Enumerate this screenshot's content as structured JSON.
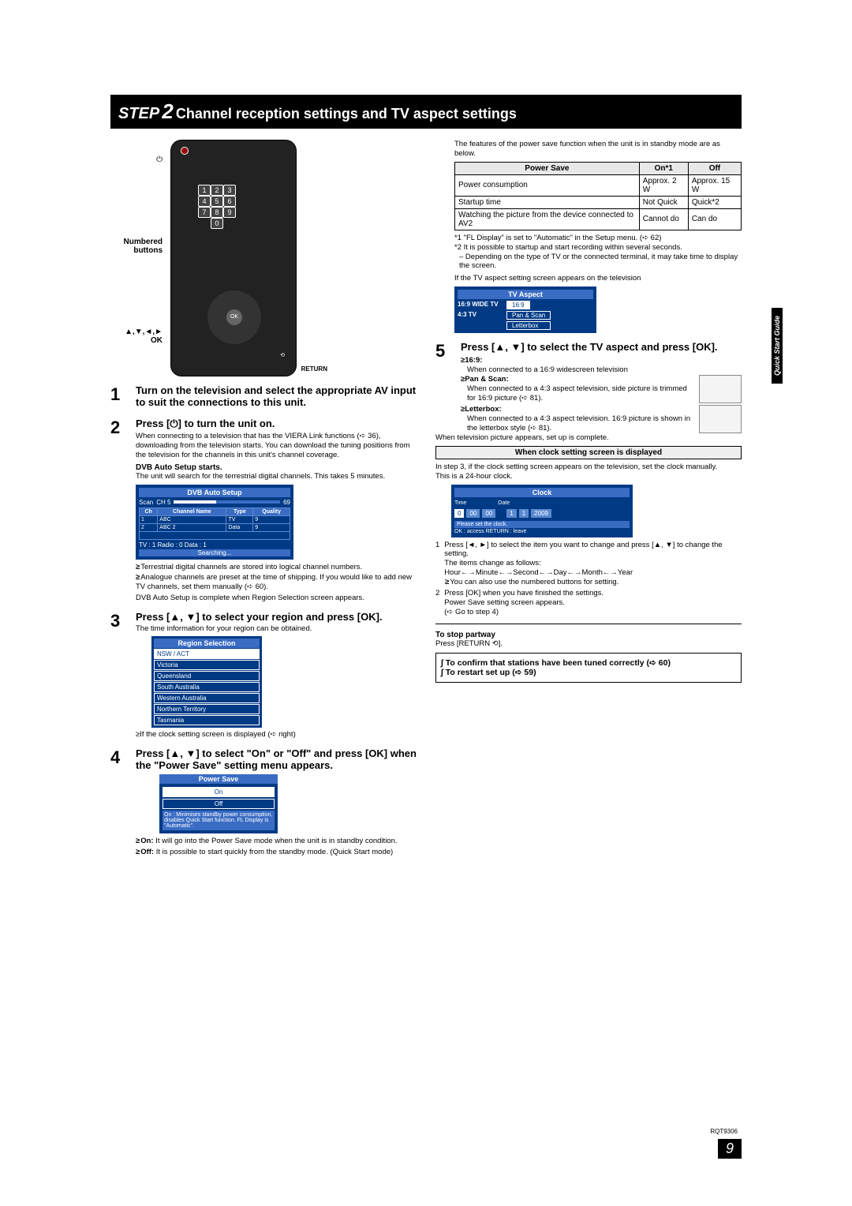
{
  "title": {
    "step": "STEP",
    "num": "2",
    "rest": " Channel reception settings and TV aspect settings"
  },
  "remote": {
    "label_numbered": "Numbered buttons",
    "label_nav": "▲,▼,◄,►\nOK",
    "label_return": "RETURN"
  },
  "steps": {
    "s1": "Turn on the television and select the appropriate AV input to suit the connections to this unit.",
    "s2": {
      "heading": "Press [⏻] to turn the unit on.",
      "body": "When connecting to a television that has the VIERA Link functions (➪ 36), downloading from the television starts. You can download the tuning positions from the television for the channels in this unit's channel coverage.",
      "dvb_head": "DVB Auto Setup starts.",
      "dvb_body": "The unit will search for the terrestrial digital channels. This takes 5 minutes.",
      "osd_title": "DVB Auto Setup",
      "osd_scan": "Scan",
      "osd_ch": "CH 5",
      "osd_prog": "69",
      "osd_th_ch": "Ch",
      "osd_th_name": "Channel Name",
      "osd_th_type": "Type",
      "osd_th_q": "Quality",
      "osd_r1_ch": "1",
      "osd_r1_n": "ABC",
      "osd_r1_t": "TV",
      "osd_r1_q": "9",
      "osd_r2_ch": "2",
      "osd_r2_n": "ABC 2",
      "osd_r2_t": "Data",
      "osd_r2_q": "9",
      "osd_counts": "TV : 1      Radio : 0      Data : 1",
      "osd_search": "Searching...",
      "bullet1": "Terrestrial digital channels are stored into logical channel numbers.",
      "bullet2": "Analogue channels are preset at the time of shipping. If you would like to add new TV channels, set them manually (➪ 60).",
      "complete": "DVB Auto Setup is complete when Region Selection screen appears."
    },
    "s3": {
      "heading": "Press [▲, ▼] to select your region and press [OK].",
      "body": "The time information for your region can be obtained.",
      "region_title": "Region Selection",
      "regions": [
        "NSW / ACT",
        "Victoria",
        "Queensland",
        "South Australia",
        "Western Australia",
        "Northern Territory",
        "Tasmania"
      ],
      "note": "≥If the clock setting screen is displayed (➪ right)"
    },
    "s4": {
      "heading": "Press [▲, ▼] to select \"On\" or \"Off\" and press [OK] when the \"Power Save\" setting menu appears.",
      "ps_title": "Power Save",
      "ps_on": "On",
      "ps_off": "Off",
      "ps_note": "On : Minimises standby power consumption, disables Quick Start function. FL Display is \"Automatic\".",
      "on_label": "On:",
      "on_desc": "It will go into the Power Save mode when the unit is in standby condition.",
      "off_label": "Off:",
      "off_desc": "It is possible to start quickly from the standby mode. (Quick Start mode)"
    },
    "ps_intro": "The features of the power save function when the unit is in standby mode are as below.",
    "table": {
      "h1": "Power Save",
      "h2": "On*1",
      "h3": "Off",
      "r1c1": "Power consumption",
      "r1c2": "Approx. 2 W",
      "r1c3": "Approx. 15 W",
      "r2c1": "Startup time",
      "r2c2": "Not Quick",
      "r2c3": "Quick*2",
      "r3c1": "Watching the picture from the device connected to AV2",
      "r3c2": "Cannot do",
      "r3c3": "Can do"
    },
    "footnote1": "*1 \"FL Display\" is set to \"Automatic\" in the Setup menu. (➪ 62)",
    "footnote2": "*2 It is possible to startup and start recording within several seconds.",
    "footnote3": "– Depending on the type of TV or the connected terminal, it may take time to display the screen.",
    "tv_intro": "If the TV aspect setting screen appears on the television",
    "tva": {
      "title": "TV Aspect",
      "l1": "16:9 WIDE TV",
      "o1": "16:9",
      "l2": "4:3 TV",
      "o2": "Pan & Scan",
      "o3": "Letterbox"
    },
    "s5": {
      "heading": "Press [▲, ▼] to select the TV aspect and press [OK].",
      "b169": "16:9:",
      "b169_d": "When connected to a 16:9 widescreen television",
      "bps": "Pan & Scan:",
      "bps_d": "When connected to a 4:3 aspect television, side picture is trimmed for 16:9 picture (➪ 81).",
      "blb": "Letterbox:",
      "blb_d": "When connected to a 4:3 aspect television. 16:9 picture is shown in the letterbox style (➪ 81).",
      "done": "When television picture appears, set up is complete."
    },
    "clock_box": "When clock setting screen is displayed",
    "clock_intro": "In step 3, if the clock setting screen appears on the television, set the clock manually.\nThis is a 24-hour clock.",
    "clock": {
      "title": "Clock",
      "time": "Time",
      "date": "Date",
      "cells": [
        "0",
        "00",
        "00",
        "1",
        "1",
        "2009"
      ],
      "hint": "Please set the clock.",
      "foot": "OK : access   RETURN : leave"
    },
    "clock_s1": "Press [◄, ►] to select the item you want to change and press [▲, ▼] to change the setting.\nThe items change as follows:\nHour←→Minute←→Second←→Day←→Month←→Year",
    "clock_bullet": "You can also use the numbered buttons for setting.",
    "clock_s2": "Press [OK] when you have finished the settings.",
    "clock_s2b": "Power Save setting screen appears.\n(➪ Go to step 4)",
    "stop_head": "To stop partway",
    "stop_body": "Press [RETURN ⟲].",
    "cross1": "∫ To confirm that stations have been tuned correctly (➪ 60)",
    "cross2": "∫ To restart set up (➪ 59)"
  },
  "sidebar": "Quick Start Guide",
  "footer": {
    "code": "RQT9306",
    "page": "9"
  }
}
